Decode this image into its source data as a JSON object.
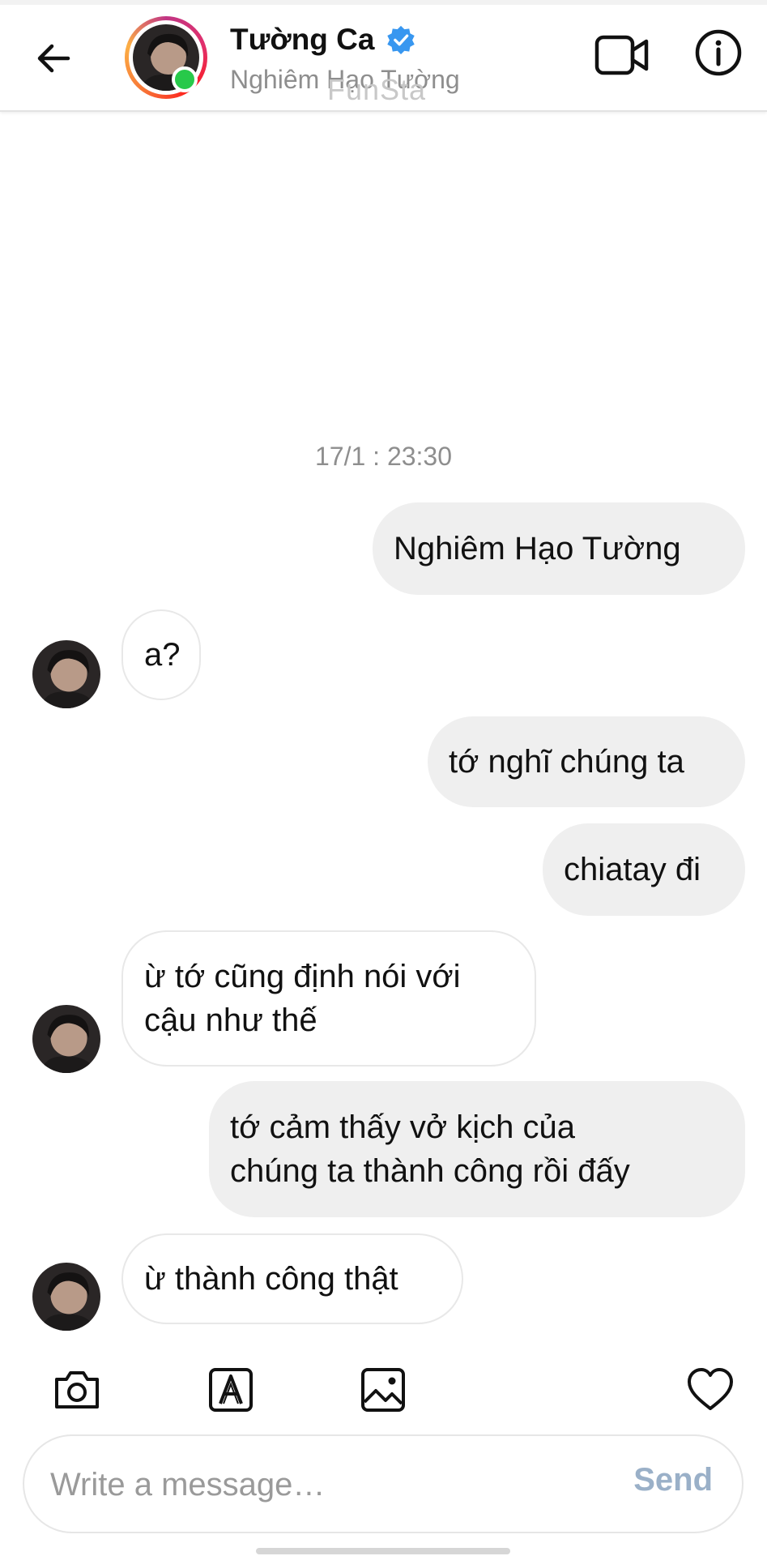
{
  "header": {
    "title": "Tường Ca",
    "subtitle": "Nghiêm Hạo Tường",
    "watermark": "FunSta",
    "icons": {
      "back": "arrow-left-icon",
      "verified": "verified-badge-icon",
      "video": "video-camera-icon",
      "info": "info-icon"
    }
  },
  "conversation": {
    "timestamp": "17/1 : 23:30",
    "messages": [
      {
        "from": "me",
        "text": "Nghiêm Hạo Tường"
      },
      {
        "from": "them",
        "text": "a?"
      },
      {
        "from": "me",
        "text": "tớ nghĩ chúng ta"
      },
      {
        "from": "me",
        "text": "chiatay đi"
      },
      {
        "from": "them",
        "lines": [
          "ừ tớ cũng định nói với",
          "cậu như thế"
        ]
      },
      {
        "from": "me",
        "lines": [
          "tớ cảm thấy vở kịch của",
          "chúng ta thành công rồi đấy"
        ]
      },
      {
        "from": "them",
        "text": "ừ thành công thật"
      }
    ]
  },
  "toolbar": {
    "icons": [
      "camera-icon",
      "text-style-icon",
      "gallery-icon",
      "heart-icon"
    ]
  },
  "composer": {
    "placeholder": "Write a message…",
    "value": "",
    "send_label": "Send"
  },
  "colors": {
    "sent_bubble": "#efefef",
    "received_border": "#e8e8e8",
    "online": "#27c94a",
    "verified": "#3897f0",
    "send_disabled": "#9ab0c8"
  }
}
